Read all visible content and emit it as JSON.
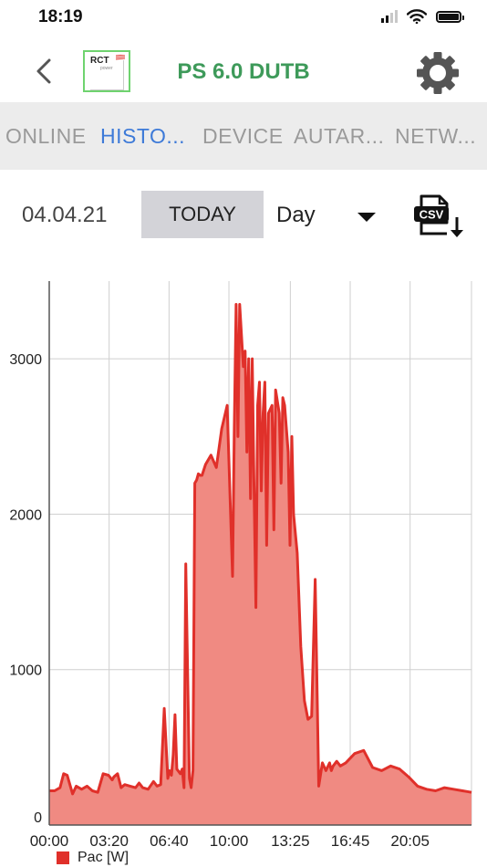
{
  "status_bar": {
    "time": "18:19"
  },
  "header": {
    "title": "PS 6.0 DUTB",
    "logo_text": "RCT",
    "logo_subtext": "power"
  },
  "tabs": [
    {
      "label": "ONLINE",
      "active": false
    },
    {
      "label": "HISTO...",
      "active": true
    },
    {
      "label": "DEVICE",
      "active": false
    },
    {
      "label": "AUTAR...",
      "active": false
    },
    {
      "label": "NETW...",
      "active": false
    }
  ],
  "controls": {
    "date": "04.04.21",
    "today_label": "TODAY",
    "period": "Day",
    "csv_label": "CSV"
  },
  "colors": {
    "accent_green": "#3e9a5a",
    "tab_active": "#3d7ad8",
    "series_line": "#e0302a",
    "series_fill": "#f08a82"
  },
  "chart_data": {
    "type": "area",
    "xlabel": "",
    "ylabel": "",
    "xlim": [
      0,
      23.5
    ],
    "ylim": [
      0,
      3500
    ],
    "grid": true,
    "legend_position": "bottom-left",
    "x_ticks": [
      {
        "value": 0,
        "label": "00:00"
      },
      {
        "value": 3.333,
        "label": "03:20"
      },
      {
        "value": 6.667,
        "label": "06:40"
      },
      {
        "value": 10,
        "label": "10:00"
      },
      {
        "value": 13.417,
        "label": "13:25"
      },
      {
        "value": 16.75,
        "label": "16:45"
      },
      {
        "value": 20.083,
        "label": "20:05"
      }
    ],
    "y_ticks": [
      0,
      1000,
      2000,
      3000
    ],
    "series": [
      {
        "name": "Pac [W]",
        "x": [
          0,
          0.3,
          0.6,
          0.8,
          1.0,
          1.3,
          1.5,
          1.8,
          2.1,
          2.4,
          2.7,
          3.0,
          3.3,
          3.5,
          3.6,
          3.8,
          4.0,
          4.2,
          4.5,
          4.8,
          5.0,
          5.2,
          5.5,
          5.8,
          6.0,
          6.2,
          6.4,
          6.6,
          6.7,
          6.8,
          6.9,
          7.0,
          7.1,
          7.3,
          7.4,
          7.5,
          7.6,
          7.8,
          7.9,
          8.0,
          8.1,
          8.2,
          8.3,
          8.4,
          8.5,
          8.7,
          9.0,
          9.3,
          9.6,
          9.9,
          10.2,
          10.3,
          10.4,
          10.5,
          10.6,
          10.8,
          10.9,
          11.0,
          11.1,
          11.2,
          11.3,
          11.4,
          11.5,
          11.6,
          11.7,
          11.8,
          11.9,
          12.0,
          12.1,
          12.2,
          12.4,
          12.5,
          12.6,
          12.8,
          12.9,
          13.0,
          13.1,
          13.3,
          13.4,
          13.5,
          13.6,
          13.8,
          14.0,
          14.2,
          14.4,
          14.6,
          14.8,
          15.0,
          15.2,
          15.4,
          15.6,
          15.7,
          15.8,
          16.0,
          16.2,
          16.5,
          17.0,
          17.5,
          18.0,
          18.5,
          19.0,
          19.5,
          20.0,
          20.5,
          21.0,
          21.5,
          22.0,
          22.5,
          23.0,
          23.5
        ],
        "values": [
          220,
          220,
          240,
          330,
          320,
          200,
          250,
          230,
          250,
          220,
          210,
          330,
          320,
          290,
          310,
          330,
          240,
          260,
          250,
          240,
          270,
          240,
          230,
          280,
          250,
          260,
          750,
          300,
          350,
          320,
          450,
          710,
          360,
          330,
          360,
          240,
          1680,
          300,
          240,
          350,
          2200,
          2220,
          2260,
          2250,
          2250,
          2320,
          2380,
          2300,
          2550,
          2700,
          1600,
          2550,
          3350,
          2500,
          3350,
          2950,
          3050,
          2400,
          3000,
          2100,
          3000,
          2150,
          1400,
          2700,
          2850,
          2150,
          2650,
          2850,
          1800,
          2650,
          2700,
          1900,
          2800,
          2650,
          2200,
          2750,
          2700,
          2400,
          1800,
          2500,
          2000,
          1750,
          1150,
          800,
          680,
          700,
          1580,
          250,
          400,
          350,
          400,
          350,
          380,
          410,
          380,
          400,
          460,
          480,
          370,
          350,
          380,
          360,
          310,
          250,
          230,
          220,
          240,
          230,
          220,
          210
        ]
      }
    ]
  }
}
